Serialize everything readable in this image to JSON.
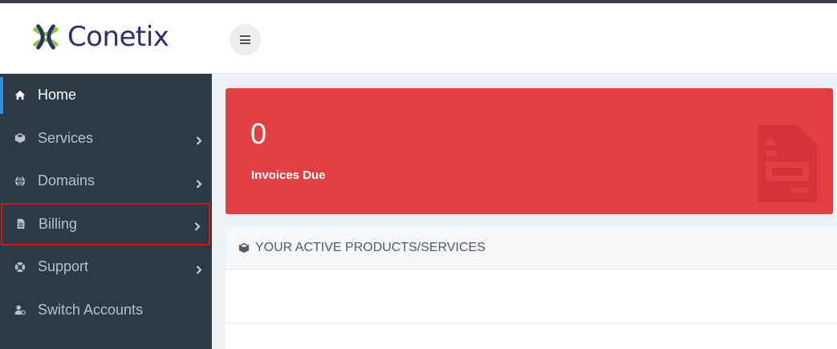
{
  "brand": {
    "name": "Conetix"
  },
  "header": {
    "menu_toggle_icon": "hamburger-icon"
  },
  "sidebar": {
    "items": [
      {
        "label": "Home",
        "icon": "home-icon",
        "active": true,
        "has_submenu": false
      },
      {
        "label": "Services",
        "icon": "cube-icon",
        "active": false,
        "has_submenu": true
      },
      {
        "label": "Domains",
        "icon": "globe-icon",
        "active": false,
        "has_submenu": true
      },
      {
        "label": "Billing",
        "icon": "file-icon",
        "active": false,
        "has_submenu": true
      },
      {
        "label": "Support",
        "icon": "life-ring-icon",
        "active": false,
        "has_submenu": true
      },
      {
        "label": "Switch Accounts",
        "icon": "user-switch-icon",
        "active": false,
        "has_submenu": false
      }
    ]
  },
  "invoices": {
    "count": "0",
    "label": "Invoices Due",
    "color": "#e33f42"
  },
  "products_panel": {
    "title": "YOUR ACTIVE PRODUCTS/SERVICES",
    "icon": "cube-icon"
  },
  "colors": {
    "sidebar_bg": "#2c3a48",
    "accent": "#2f8fd8",
    "brand": "#2b2f6b"
  }
}
